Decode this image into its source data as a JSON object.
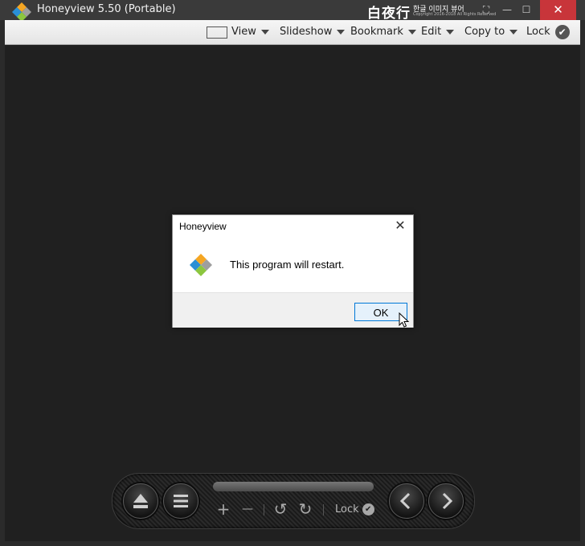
{
  "window": {
    "title": "Honeyview 5.50 (Portable)",
    "brand": "白夜行",
    "brand_sub": "한글 이미지 뷰어",
    "brand_copyright": "Copyright 2016-2018 All Rights Reserved",
    "close_glyph": "✕",
    "minimize_glyph": "—",
    "maximize_glyph": "☐",
    "fullscreen_glyph": "⛶"
  },
  "menu": {
    "items": [
      {
        "label": "View"
      },
      {
        "label": "Slideshow"
      },
      {
        "label": "Bookmark"
      },
      {
        "label": "Edit"
      },
      {
        "label": "Copy to"
      },
      {
        "label": "Lock"
      }
    ],
    "check_glyph": "✔"
  },
  "dialog": {
    "title": "Honeyview",
    "message": "This program will restart.",
    "ok_label": "OK",
    "close_glyph": "✕"
  },
  "toolbar": {
    "zoom_in_glyph": "+",
    "zoom_out_glyph": "—",
    "rotate_left_glyph": "↺",
    "rotate_right_glyph": "↻",
    "lock_label": "Lock",
    "lock_check_glyph": "✔"
  },
  "colors": {
    "accent": "#0078d7",
    "close_red": "#c8353a",
    "viewer_bg": "#202020",
    "titlebar_bg": "#3a3a3a"
  }
}
